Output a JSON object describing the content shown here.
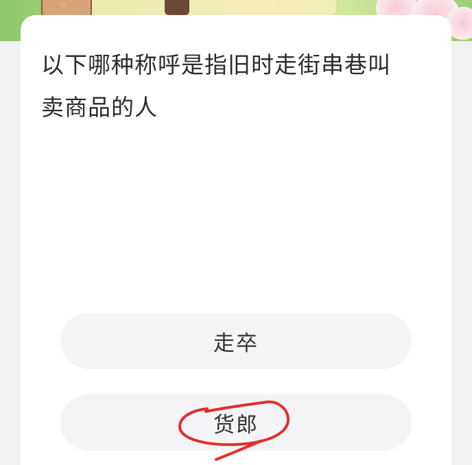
{
  "question": {
    "text": "以下哪种称呼是指旧时走街串巷叫卖商品的人"
  },
  "options": [
    {
      "label": "走卒"
    },
    {
      "label": "货郎"
    }
  ],
  "colors": {
    "annotation": "#e0302a",
    "option_bg": "#f4f4f6",
    "card_bg": "#ffffff",
    "page_bg": "#f2f2f4"
  }
}
